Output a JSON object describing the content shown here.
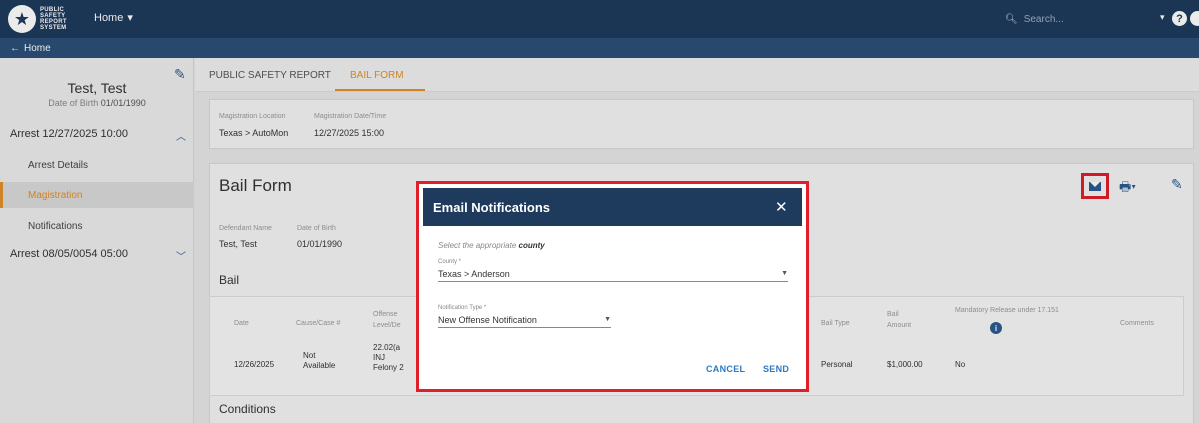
{
  "topbar": {
    "logo_lines": [
      "PUBLIC",
      "SAFETY",
      "REPORT",
      "SYSTEM"
    ],
    "home_label": "Home",
    "search_placeholder": "Search..."
  },
  "subbar": {
    "back_label": "Home"
  },
  "sidebar": {
    "person_name": "Test, Test",
    "dob_label": "Date of Birth",
    "dob_value": "01/01/1990",
    "arrest1_label": "Arrest 12/27/2025 10:00",
    "nav_items": [
      "Arrest Details",
      "Magistration",
      "Notifications"
    ],
    "active_item": "Magistration",
    "arrest2_label": "Arrest 08/05/0054 05:00"
  },
  "tabs": [
    "PUBLIC SAFETY REPORT",
    "BAIL FORM"
  ],
  "magistration": {
    "location_label": "Magistration Location",
    "location_value": "Texas > AutoMon",
    "datetime_label": "Magistration Date/Time",
    "datetime_value": "12/27/2025 15:00"
  },
  "bail_form": {
    "title": "Bail Form",
    "defendant_label": "Defendant Name",
    "defendant_value": "Test, Test",
    "dob_label": "Date of Birth",
    "dob_value": "01/01/1990",
    "bail_heading": "Bail",
    "conditions_heading": "Conditions"
  },
  "bail_table": {
    "headers": {
      "date": "Date",
      "cause": "Cause/Case #",
      "offense": [
        "Offense",
        "Level/De"
      ],
      "bail_type": "Bail Type",
      "bail_amount": [
        "Bail",
        "Amount"
      ],
      "mandatory": "Mandatory Release under 17.151",
      "comments": "Comments"
    },
    "row": {
      "date": "12/26/2025",
      "cause": [
        "Not",
        "Available"
      ],
      "offense": [
        "22.02(a",
        "INJ",
        "Felony 2"
      ],
      "bail_type": "Personal",
      "bail_amount": "$1,000.00",
      "mandatory": "No",
      "comments": ""
    }
  },
  "modal": {
    "title": "Email Notifications",
    "hint_prefix": "Select the appropriate",
    "hint_bold": "county",
    "county_label": "County *",
    "county_value": "Texas > Anderson",
    "type_label": "Notification Type *",
    "type_value": "New Offense Notification",
    "cancel_label": "CANCEL",
    "send_label": "SEND"
  },
  "colors": {
    "header_navy": "#1e3a5c",
    "accent_orange": "#e0902a",
    "highlight_red": "#e01f2b",
    "link_blue": "#2a7ac2"
  }
}
